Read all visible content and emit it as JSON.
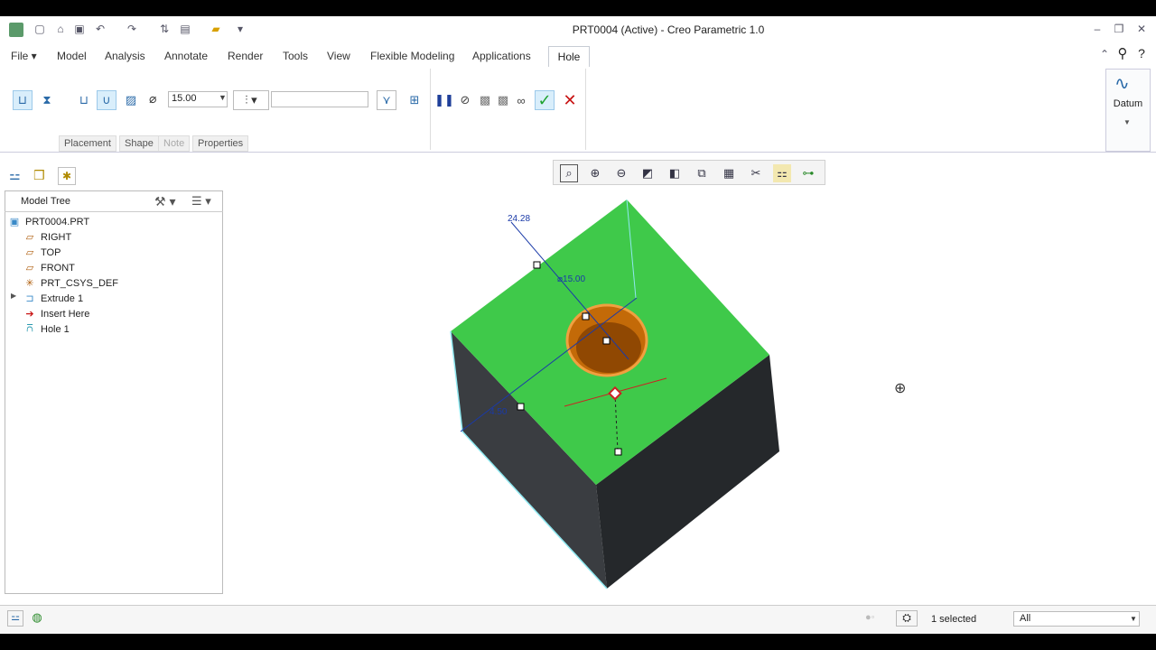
{
  "window": {
    "title": "PRT0004 (Active) - Creo Parametric 1.0"
  },
  "menus": {
    "file": "File",
    "items": [
      "Model",
      "Analysis",
      "Annotate",
      "Render",
      "Tools",
      "View",
      "Flexible Modeling",
      "Applications"
    ],
    "active_tab": "Hole"
  },
  "ribbon": {
    "diameter_value": "15.00",
    "depth_value": "",
    "subtabs": [
      "Placement",
      "Shape",
      "Note",
      "Properties"
    ],
    "datum_label": "Datum"
  },
  "model_tree": {
    "header": "Model Tree",
    "items": [
      {
        "label": "PRT0004.PRT",
        "icon": "part-icon"
      },
      {
        "label": "RIGHT",
        "icon": "datum-plane-icon"
      },
      {
        "label": "TOP",
        "icon": "datum-plane-icon"
      },
      {
        "label": "FRONT",
        "icon": "datum-plane-icon"
      },
      {
        "label": "PRT_CSYS_DEF",
        "icon": "csys-icon"
      },
      {
        "label": "Extrude 1",
        "icon": "extrude-icon"
      },
      {
        "label": "Insert Here",
        "icon": "insert-arrow-icon"
      },
      {
        "label": "Hole 1",
        "icon": "hole-icon"
      }
    ]
  },
  "viewport": {
    "dim_offset": "24.28",
    "dim_diameter": "⌀15.00",
    "dim_offset2": "4.50",
    "colors": {
      "top_face": "#3fc94a",
      "side_face": "#2c2f33",
      "hole": "#c36a08",
      "dim": "#1a3aa8",
      "axis": "#cc2222"
    }
  },
  "status": {
    "selected": "1 selected",
    "filter": "All"
  }
}
